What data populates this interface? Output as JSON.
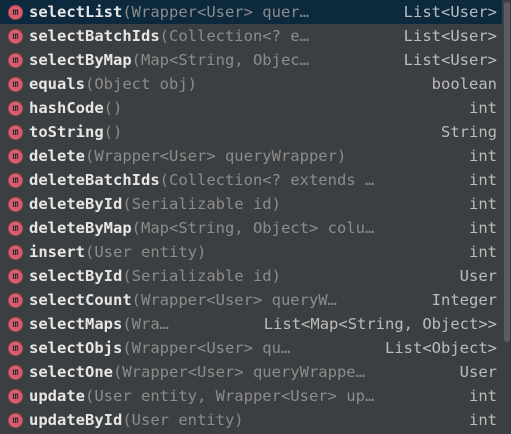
{
  "completion": {
    "items": [
      {
        "name": "selectList",
        "params": "(Wrapper<User> quer…",
        "type": "List<User>"
      },
      {
        "name": "selectBatchIds",
        "params": "(Collection<? e…",
        "type": "List<User>"
      },
      {
        "name": "selectByMap",
        "params": "(Map<String, Objec…",
        "type": "List<User>"
      },
      {
        "name": "equals",
        "params": "(Object obj)",
        "type": "boolean"
      },
      {
        "name": "hashCode",
        "params": "()",
        "type": "int"
      },
      {
        "name": "toString",
        "params": "()",
        "type": "String"
      },
      {
        "name": "delete",
        "params": "(Wrapper<User> queryWrapper)",
        "type": "int"
      },
      {
        "name": "deleteBatchIds",
        "params": "(Collection<? extends …",
        "type": "int"
      },
      {
        "name": "deleteById",
        "params": "(Serializable id)",
        "type": "int"
      },
      {
        "name": "deleteByMap",
        "params": "(Map<String, Object> colu…",
        "type": "int"
      },
      {
        "name": "insert",
        "params": "(User entity)",
        "type": "int"
      },
      {
        "name": "selectById",
        "params": "(Serializable id)",
        "type": "User"
      },
      {
        "name": "selectCount",
        "params": "(Wrapper<User> queryW…",
        "type": "Integer"
      },
      {
        "name": "selectMaps",
        "params": "(Wra…",
        "type": "List<Map<String, Object>>"
      },
      {
        "name": "selectObjs",
        "params": "(Wrapper<User> qu…",
        "type": "List<Object>"
      },
      {
        "name": "selectOne",
        "params": "(Wrapper<User> queryWrappe…",
        "type": "User"
      },
      {
        "name": "update",
        "params": "(User entity, Wrapper<User> up…",
        "type": "int"
      },
      {
        "name": "updateById",
        "params": "(User entity)",
        "type": "int"
      }
    ],
    "selected_index": 0,
    "icon": "method-icon",
    "colors": {
      "background": "#3c3f41",
      "selected": "#0d293e",
      "method_icon": "#d95d6e",
      "name": "#e6e6e6",
      "params": "#8c8c8c",
      "type": "#bcbcbc"
    }
  }
}
